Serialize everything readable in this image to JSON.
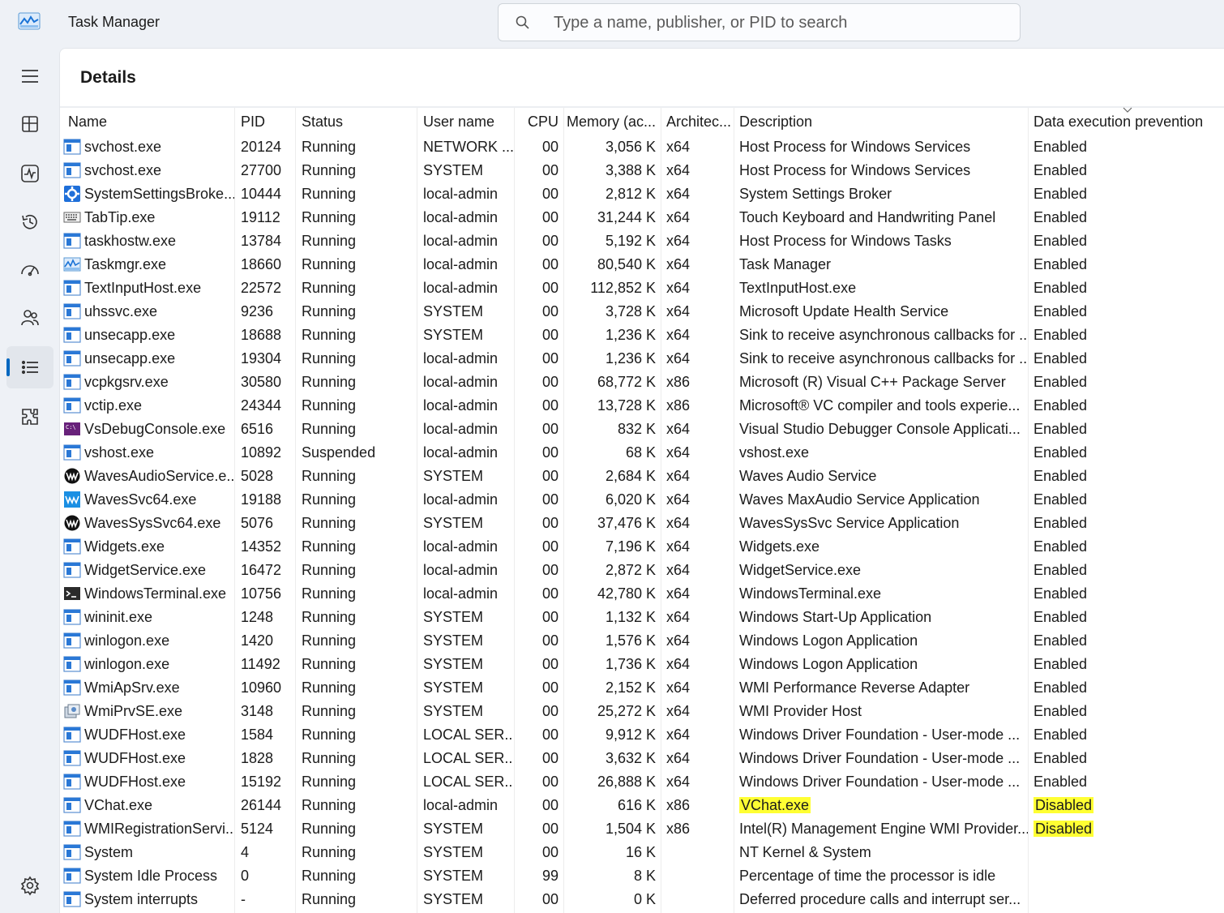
{
  "app": {
    "title": "Task Manager"
  },
  "search": {
    "placeholder": "Type a name, publisher, or PID to search"
  },
  "nav": {
    "items": [
      {
        "name": "hamburger-menu-icon"
      },
      {
        "name": "processes-icon"
      },
      {
        "name": "performance-icon"
      },
      {
        "name": "app-history-icon"
      },
      {
        "name": "startup-apps-icon"
      },
      {
        "name": "users-icon"
      },
      {
        "name": "details-icon",
        "active": true
      },
      {
        "name": "services-icon"
      }
    ],
    "settings": {
      "name": "settings-icon"
    }
  },
  "page": {
    "title": "Details"
  },
  "columns": [
    "Name",
    "PID",
    "Status",
    "User name",
    "CPU",
    "Memory (ac...",
    "Architec...",
    "Description",
    "Data execution prevention"
  ],
  "highlight_color": "#ffff33",
  "rows": [
    {
      "icon": "window",
      "name": "svchost.exe",
      "pid": "20124",
      "status": "Running",
      "user": "NETWORK ...",
      "cpu": "00",
      "mem": "3,056 K",
      "arch": "x64",
      "desc": "Host Process for Windows Services",
      "dep": "Enabled"
    },
    {
      "icon": "window",
      "name": "svchost.exe",
      "pid": "27700",
      "status": "Running",
      "user": "SYSTEM",
      "cpu": "00",
      "mem": "3,388 K",
      "arch": "x64",
      "desc": "Host Process for Windows Services",
      "dep": "Enabled"
    },
    {
      "icon": "gear",
      "name": "SystemSettingsBroke...",
      "pid": "10444",
      "status": "Running",
      "user": "local-admin",
      "cpu": "00",
      "mem": "2,812 K",
      "arch": "x64",
      "desc": "System Settings Broker",
      "dep": "Enabled"
    },
    {
      "icon": "keyboard",
      "name": "TabTip.exe",
      "pid": "19112",
      "status": "Running",
      "user": "local-admin",
      "cpu": "00",
      "mem": "31,244 K",
      "arch": "x64",
      "desc": "Touch Keyboard and Handwriting Panel",
      "dep": "Enabled"
    },
    {
      "icon": "window",
      "name": "taskhostw.exe",
      "pid": "13784",
      "status": "Running",
      "user": "local-admin",
      "cpu": "00",
      "mem": "5,192 K",
      "arch": "x64",
      "desc": "Host Process for Windows Tasks",
      "dep": "Enabled"
    },
    {
      "icon": "taskmgr",
      "name": "Taskmgr.exe",
      "pid": "18660",
      "status": "Running",
      "user": "local-admin",
      "cpu": "00",
      "mem": "80,540 K",
      "arch": "x64",
      "desc": "Task Manager",
      "dep": "Enabled"
    },
    {
      "icon": "window",
      "name": "TextInputHost.exe",
      "pid": "22572",
      "status": "Running",
      "user": "local-admin",
      "cpu": "00",
      "mem": "112,852 K",
      "arch": "x64",
      "desc": "TextInputHost.exe",
      "dep": "Enabled"
    },
    {
      "icon": "window",
      "name": "uhssvc.exe",
      "pid": "9236",
      "status": "Running",
      "user": "SYSTEM",
      "cpu": "00",
      "mem": "3,728 K",
      "arch": "x64",
      "desc": "Microsoft Update Health Service",
      "dep": "Enabled"
    },
    {
      "icon": "window",
      "name": "unsecapp.exe",
      "pid": "18688",
      "status": "Running",
      "user": "SYSTEM",
      "cpu": "00",
      "mem": "1,236 K",
      "arch": "x64",
      "desc": "Sink to receive asynchronous callbacks for ...",
      "dep": "Enabled"
    },
    {
      "icon": "window",
      "name": "unsecapp.exe",
      "pid": "19304",
      "status": "Running",
      "user": "local-admin",
      "cpu": "00",
      "mem": "1,236 K",
      "arch": "x64",
      "desc": "Sink to receive asynchronous callbacks for ...",
      "dep": "Enabled"
    },
    {
      "icon": "window",
      "name": "vcpkgsrv.exe",
      "pid": "30580",
      "status": "Running",
      "user": "local-admin",
      "cpu": "00",
      "mem": "68,772 K",
      "arch": "x86",
      "desc": "Microsoft (R) Visual C++ Package Server",
      "dep": "Enabled"
    },
    {
      "icon": "window",
      "name": "vctip.exe",
      "pid": "24344",
      "status": "Running",
      "user": "local-admin",
      "cpu": "00",
      "mem": "13,728 K",
      "arch": "x86",
      "desc": "Microsoft® VC compiler and tools experie...",
      "dep": "Enabled"
    },
    {
      "icon": "vsconsole",
      "name": "VsDebugConsole.exe",
      "pid": "6516",
      "status": "Running",
      "user": "local-admin",
      "cpu": "00",
      "mem": "832 K",
      "arch": "x64",
      "desc": "Visual Studio Debugger Console Applicati...",
      "dep": "Enabled"
    },
    {
      "icon": "window",
      "name": "vshost.exe",
      "pid": "10892",
      "status": "Suspended",
      "user": "local-admin",
      "cpu": "00",
      "mem": "68 K",
      "arch": "x64",
      "desc": "vshost.exe",
      "dep": "Enabled"
    },
    {
      "icon": "waves-dark",
      "name": "WavesAudioService.e...",
      "pid": "5028",
      "status": "Running",
      "user": "SYSTEM",
      "cpu": "00",
      "mem": "2,684 K",
      "arch": "x64",
      "desc": "Waves Audio Service",
      "dep": "Enabled"
    },
    {
      "icon": "waves-blue",
      "name": "WavesSvc64.exe",
      "pid": "19188",
      "status": "Running",
      "user": "local-admin",
      "cpu": "00",
      "mem": "6,020 K",
      "arch": "x64",
      "desc": "Waves MaxAudio Service Application",
      "dep": "Enabled"
    },
    {
      "icon": "waves-dark",
      "name": "WavesSysSvc64.exe",
      "pid": "5076",
      "status": "Running",
      "user": "SYSTEM",
      "cpu": "00",
      "mem": "37,476 K",
      "arch": "x64",
      "desc": "WavesSysSvc Service Application",
      "dep": "Enabled"
    },
    {
      "icon": "window",
      "name": "Widgets.exe",
      "pid": "14352",
      "status": "Running",
      "user": "local-admin",
      "cpu": "00",
      "mem": "7,196 K",
      "arch": "x64",
      "desc": "Widgets.exe",
      "dep": "Enabled"
    },
    {
      "icon": "window",
      "name": "WidgetService.exe",
      "pid": "16472",
      "status": "Running",
      "user": "local-admin",
      "cpu": "00",
      "mem": "2,872 K",
      "arch": "x64",
      "desc": "WidgetService.exe",
      "dep": "Enabled"
    },
    {
      "icon": "terminal",
      "name": "WindowsTerminal.exe",
      "pid": "10756",
      "status": "Running",
      "user": "local-admin",
      "cpu": "00",
      "mem": "42,780 K",
      "arch": "x64",
      "desc": "WindowsTerminal.exe",
      "dep": "Enabled"
    },
    {
      "icon": "window",
      "name": "wininit.exe",
      "pid": "1248",
      "status": "Running",
      "user": "SYSTEM",
      "cpu": "00",
      "mem": "1,132 K",
      "arch": "x64",
      "desc": "Windows Start-Up Application",
      "dep": "Enabled"
    },
    {
      "icon": "window",
      "name": "winlogon.exe",
      "pid": "1420",
      "status": "Running",
      "user": "SYSTEM",
      "cpu": "00",
      "mem": "1,576 K",
      "arch": "x64",
      "desc": "Windows Logon Application",
      "dep": "Enabled"
    },
    {
      "icon": "window",
      "name": "winlogon.exe",
      "pid": "11492",
      "status": "Running",
      "user": "SYSTEM",
      "cpu": "00",
      "mem": "1,736 K",
      "arch": "x64",
      "desc": "Windows Logon Application",
      "dep": "Enabled"
    },
    {
      "icon": "window",
      "name": "WmiApSrv.exe",
      "pid": "10960",
      "status": "Running",
      "user": "SYSTEM",
      "cpu": "00",
      "mem": "2,152 K",
      "arch": "x64",
      "desc": "WMI Performance Reverse Adapter",
      "dep": "Enabled"
    },
    {
      "icon": "wmi",
      "name": "WmiPrvSE.exe",
      "pid": "3148",
      "status": "Running",
      "user": "SYSTEM",
      "cpu": "00",
      "mem": "25,272 K",
      "arch": "x64",
      "desc": "WMI Provider Host",
      "dep": "Enabled"
    },
    {
      "icon": "window",
      "name": "WUDFHost.exe",
      "pid": "1584",
      "status": "Running",
      "user": "LOCAL SER...",
      "cpu": "00",
      "mem": "9,912 K",
      "arch": "x64",
      "desc": "Windows Driver Foundation - User-mode ...",
      "dep": "Enabled"
    },
    {
      "icon": "window",
      "name": "WUDFHost.exe",
      "pid": "1828",
      "status": "Running",
      "user": "LOCAL SER...",
      "cpu": "00",
      "mem": "3,632 K",
      "arch": "x64",
      "desc": "Windows Driver Foundation - User-mode ...",
      "dep": "Enabled"
    },
    {
      "icon": "window",
      "name": "WUDFHost.exe",
      "pid": "15192",
      "status": "Running",
      "user": "LOCAL SER...",
      "cpu": "00",
      "mem": "26,888 K",
      "arch": "x64",
      "desc": "Windows Driver Foundation - User-mode ...",
      "dep": "Enabled"
    },
    {
      "icon": "window",
      "name": "VChat.exe",
      "pid": "26144",
      "status": "Running",
      "user": "local-admin",
      "cpu": "00",
      "mem": "616 K",
      "arch": "x86",
      "desc": "VChat.exe",
      "dep": "Disabled",
      "hl_desc": true,
      "hl_dep": true
    },
    {
      "icon": "window",
      "name": "WMIRegistrationServi...",
      "pid": "5124",
      "status": "Running",
      "user": "SYSTEM",
      "cpu": "00",
      "mem": "1,504 K",
      "arch": "x86",
      "desc": "Intel(R) Management Engine WMI Provider...",
      "dep": "Disabled",
      "hl_dep": true
    },
    {
      "icon": "window",
      "name": "System",
      "pid": "4",
      "status": "Running",
      "user": "SYSTEM",
      "cpu": "00",
      "mem": "16 K",
      "arch": "",
      "desc": "NT Kernel & System",
      "dep": ""
    },
    {
      "icon": "window",
      "name": "System Idle Process",
      "pid": "0",
      "status": "Running",
      "user": "SYSTEM",
      "cpu": "99",
      "mem": "8 K",
      "arch": "",
      "desc": "Percentage of time the processor is idle",
      "dep": ""
    },
    {
      "icon": "window",
      "name": "System interrupts",
      "pid": "-",
      "status": "Running",
      "user": "SYSTEM",
      "cpu": "00",
      "mem": "0 K",
      "arch": "",
      "desc": "Deferred procedure calls and interrupt ser...",
      "dep": ""
    }
  ]
}
